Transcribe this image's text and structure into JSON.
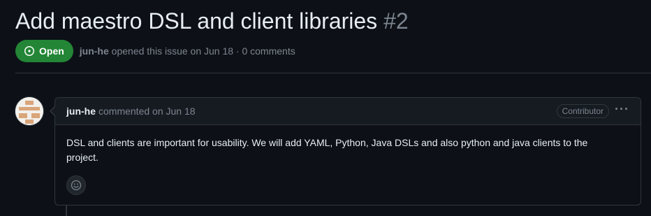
{
  "issue": {
    "title": "Add maestro DSL and client libraries",
    "number": "#2",
    "state": "Open",
    "author": "jun-he",
    "meta_text": "opened this issue on Jun 18 · 0 comments"
  },
  "comment": {
    "author": "jun-he",
    "action": "commented on Jun 18",
    "role_badge": "Contributor",
    "menu_glyph": "···",
    "body": "DSL and clients are important for usability. We will add YAML, Python, Java DSLs and also python and java clients to the project."
  },
  "colors": {
    "background": "#0d1117",
    "open_badge": "#238636",
    "border": "#30363d",
    "muted_text": "#7d8590"
  }
}
